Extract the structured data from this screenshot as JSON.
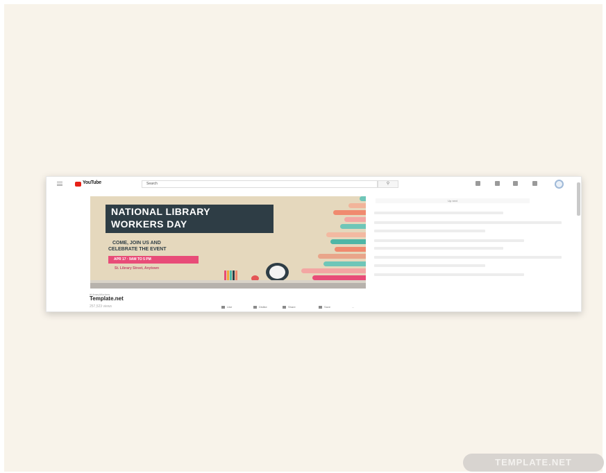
{
  "browser": {
    "logo_text": "YouTube",
    "search_placeholder": "Search",
    "search_button_icon": "search-icon",
    "top_icons": [
      "upload-icon",
      "apps-icon",
      "chat-icon",
      "notifications-icon"
    ]
  },
  "video": {
    "title_line_1": "NATIONAL LIBRARY",
    "title_line_2": "WORKERS DAY",
    "subtitle_line_1": "COME, JOIN US AND",
    "subtitle_line_2": "CELEBRATE THE EVENT",
    "date_time": "APR 17 · 9AM TO 5 PM",
    "venue": "St. Library Street, Anytown"
  },
  "meta": {
    "small_label": "#LibraryWorkers",
    "channel": "Template.net",
    "views": "257,523 views",
    "actions": [
      "Like",
      "Dislike",
      "Share",
      "Save",
      "..."
    ]
  },
  "sidebar": {
    "header": "Up next"
  },
  "watermark": "TEMPLATE.NET",
  "colors": {
    "background": "#f8f3ea",
    "banner_bg": "#e5d8bd",
    "title_plate": "#2e3d45",
    "ribbon": "#e84c78",
    "accent_red": "#e62117"
  }
}
